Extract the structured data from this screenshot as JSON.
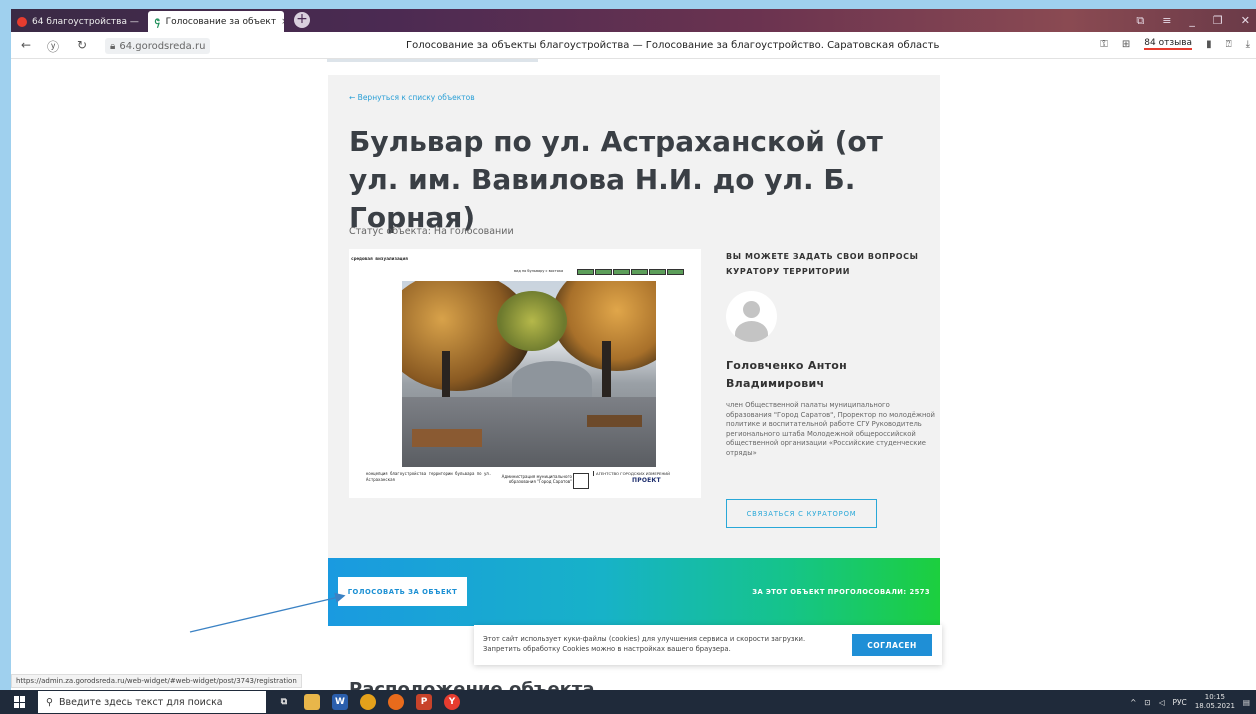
{
  "browser": {
    "tabs": [
      {
        "label": "64 благоустройства —",
        "active": false
      },
      {
        "label": "Голосование за объект",
        "active": true
      }
    ],
    "domain": "64.gorodsreda.ru",
    "page_title": "Голосование за объекты благоустройства — Голосование за благоустройство. Саратовская область",
    "reviews_label": "84 отзыва",
    "status_url": "https://admin.za.gorodsreda.ru/web-widget/#web-widget/post/3743/registration"
  },
  "page": {
    "back_link": "← Вернуться к списку объектов",
    "heading": "Бульвар по ул. Астраханской (от ул. им. Вавилова Н.И. до ул. Б. Горная)",
    "status": "Статус объекта: На голосовании",
    "image": {
      "caption_top": "средовая визуализация",
      "caption_top_right": "вид по бульвару с востока",
      "foot_left": "концепция благоустройства территории бульвара по ул. Астраханская",
      "foot_admin": "Администрация муниципального образования \"Город Саратов\"",
      "foot_agency": "АГЕНТСТВО ГОРОДСКИХ ИЗМЕРЕНИЙ",
      "foot_logo": "ПРОЕКТ"
    },
    "curator": {
      "title": "ВЫ МОЖЕТЕ ЗАДАТЬ СВОИ ВОПРОСЫ КУРАТОРУ ТЕРРИТОРИИ",
      "name": "Головченко Антон Владимирович",
      "description": "член Общественной палаты муниципального образования \"Город Саратов\", Проректор по молодёжной политике и воспитательной работе СГУ Руководитель регионального штаба Молодежной общероссийской общественной организации «Российские студенческие отряды»",
      "contact_button": "СВЯЗАТЬСЯ С КУРАТОРОМ"
    },
    "vote": {
      "button": "ГОЛОСОВАТЬ ЗА ОБЪЕКТ",
      "count_label": "ЗА ЭТОТ ОБЪЕКТ ПРОГОЛОСОВАЛИ:",
      "count": "2573"
    },
    "location_title": "Расположение объекта",
    "cookie": {
      "text": "Этот сайт использует куки-файлы (cookies) для улучшения сервиса и скорости загрузки. Запретить обработку Cookies можно в настройках вашего браузера.",
      "button": "СОГЛАСЕН"
    }
  },
  "taskbar": {
    "search_placeholder": "Введите здесь текст для поиска",
    "lang": "РУС",
    "time": "10:15",
    "date": "18.05.2021"
  },
  "colors": {
    "accent_blue": "#1f8fd6",
    "gradient_start": "#1a9ae0",
    "gradient_end": "#1ccf3e"
  }
}
